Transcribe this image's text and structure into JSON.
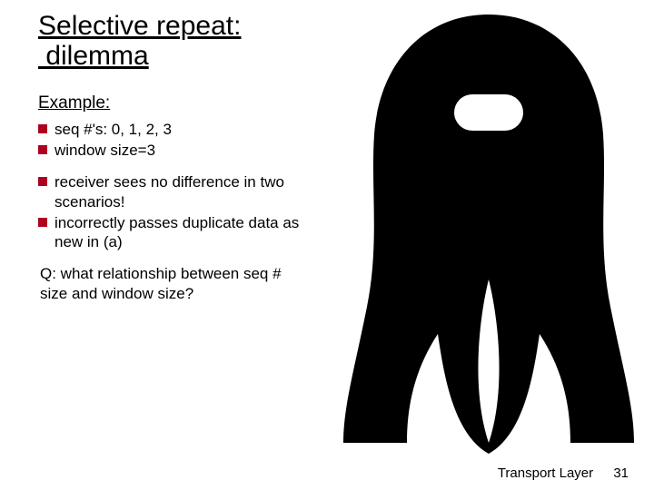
{
  "title": "Selective repeat:\n dilemma",
  "example_heading": "Example:",
  "bullets_a": [
    "seq #'s: 0, 1, 2, 3",
    "window size=3"
  ],
  "bullets_b": [
    "receiver sees no difference in two scenarios!",
    "incorrectly passes duplicate data as new in (a)"
  ],
  "question_label": "Q:",
  "question_text": " what relationship between seq # size and window size?",
  "footer_label": "Transport Layer",
  "footer_page": "31"
}
